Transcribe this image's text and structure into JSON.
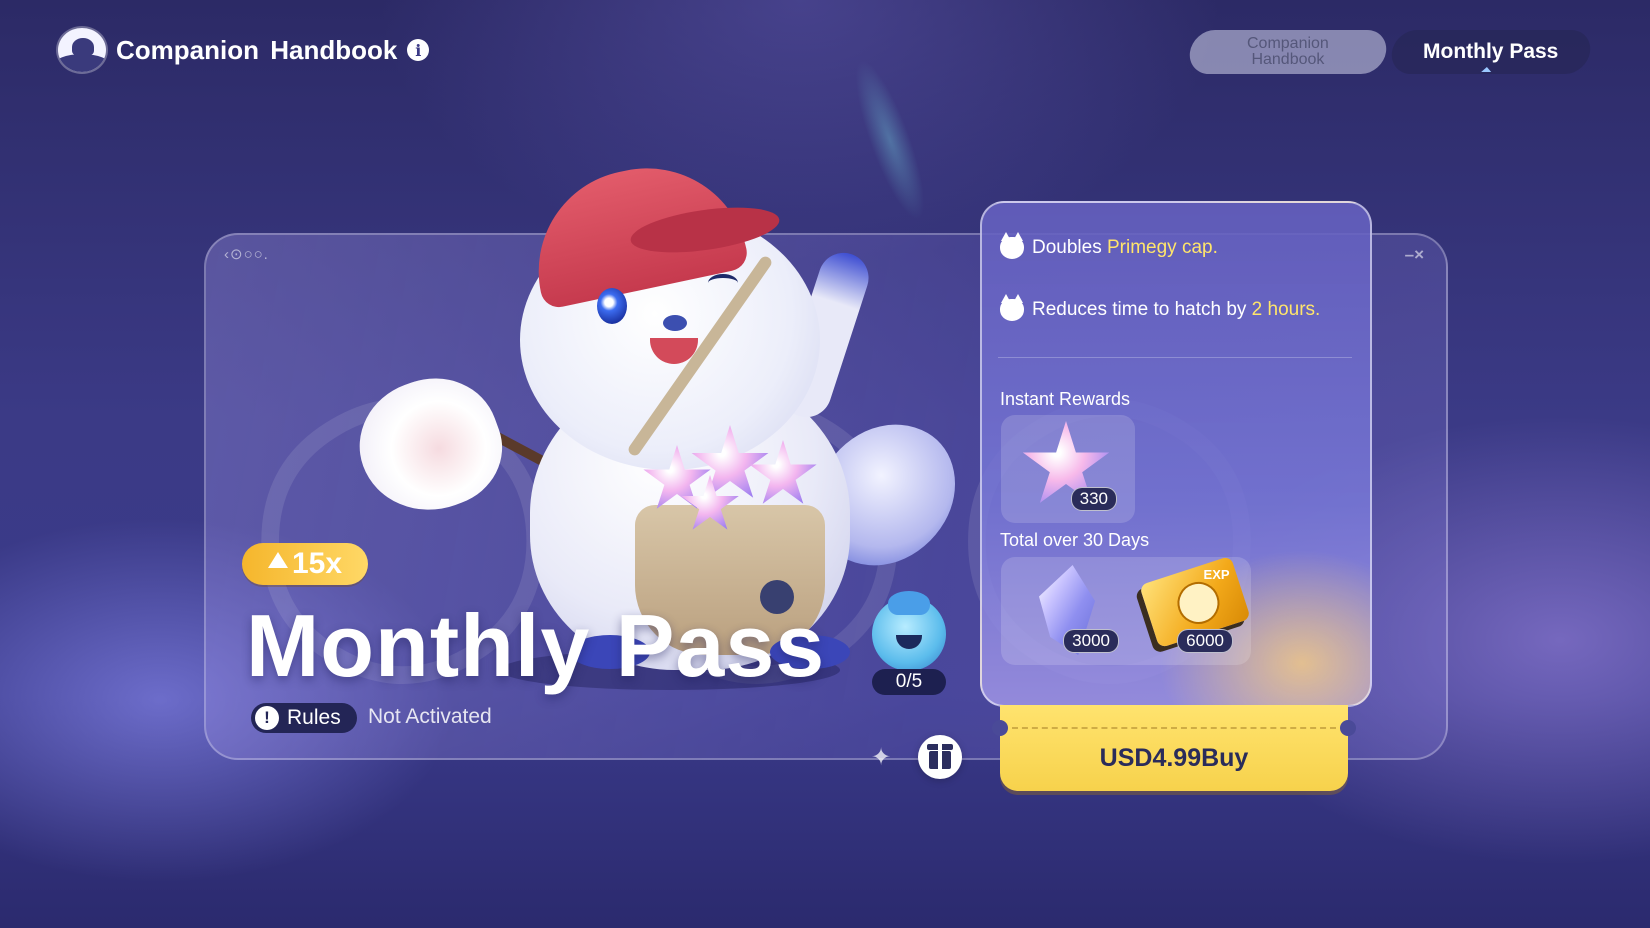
{
  "header": {
    "title": "Companion Handbook",
    "info_icon": "i"
  },
  "tabs": [
    {
      "label": "Companion\nHandbook",
      "active": false
    },
    {
      "label": "Monthly Pass",
      "active": true
    }
  ],
  "card": {
    "deco_top_left": "‹⊙○○.",
    "deco_top_right": "–×"
  },
  "hero": {
    "multiplier": "15x",
    "title": "Monthly Pass",
    "rules_label": "Rules",
    "rules_icon": "!",
    "status": "Not Activated",
    "companion_count": "0/5"
  },
  "benefits": [
    {
      "prefix": "Doubles ",
      "highlight": "Primegy cap.",
      "suffix": ""
    },
    {
      "prefix": "Reduces time to hatch by ",
      "highlight": "2 hours.",
      "suffix": ""
    }
  ],
  "instant_rewards": {
    "label": "Instant Rewards",
    "items": [
      {
        "icon": "star-crystal",
        "qty": "330"
      }
    ]
  },
  "total_rewards": {
    "label": "Total over 30 Days",
    "items": [
      {
        "icon": "crystal",
        "qty": "3000"
      },
      {
        "icon": "exp-ticket",
        "qty": "6000"
      }
    ]
  },
  "buy": {
    "label": "USD4.99Buy"
  },
  "colors": {
    "highlight": "#ffe56b",
    "buy_button": "#f7d24c",
    "multiplier_badge": "#f5b62c"
  }
}
